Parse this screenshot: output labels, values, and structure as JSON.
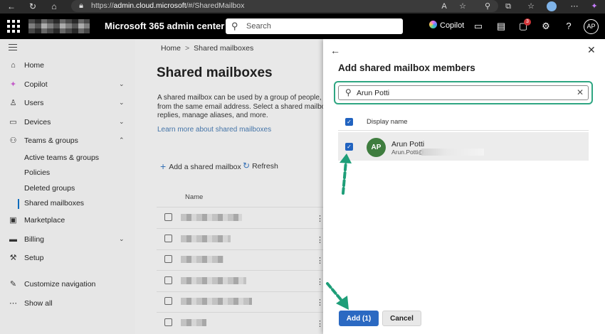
{
  "browser": {
    "url_prefix": "https://",
    "url_host": "admin.cloud.microsoft",
    "url_path": "/#/SharedMailbox",
    "notification_count": "3"
  },
  "header": {
    "app_title": "Microsoft 365 admin center",
    "search_placeholder": "Search",
    "copilot_label": "Copilot",
    "badge_count": "3",
    "avatar_initials": "AP"
  },
  "sidebar": {
    "items": [
      {
        "label": "Home",
        "icon": "home-icon"
      },
      {
        "label": "Copilot",
        "icon": "copilot-icon"
      },
      {
        "label": "Users",
        "icon": "user-icon"
      },
      {
        "label": "Devices",
        "icon": "devices-icon"
      },
      {
        "label": "Teams & groups",
        "icon": "teams-icon"
      },
      {
        "label": "Active teams & groups"
      },
      {
        "label": "Policies"
      },
      {
        "label": "Deleted groups"
      },
      {
        "label": "Shared mailboxes"
      },
      {
        "label": "Marketplace",
        "icon": "marketplace-icon"
      },
      {
        "label": "Billing",
        "icon": "billing-icon"
      },
      {
        "label": "Setup",
        "icon": "setup-icon"
      },
      {
        "label": "Customize navigation",
        "icon": "pencil-icon"
      },
      {
        "label": "Show all",
        "icon": "ellipsis-icon"
      }
    ]
  },
  "main": {
    "breadcrumb": [
      "Home",
      "Shared mailboxes"
    ],
    "title": "Shared mailboxes",
    "description": [
      "A shared mailbox can be used by a group of people, like",
      "from the same email address. Select a shared mailbox to",
      "replies, manage aliases, and more."
    ],
    "learn_more": "Learn more about shared mailboxes",
    "add_label": "Add a shared mailbox",
    "refresh_label": "Refresh",
    "name_column": "Name"
  },
  "panel": {
    "title": "Add shared mailbox members",
    "search_value": "Arun Potti",
    "column_header": "Display name",
    "results": [
      {
        "initials": "AP",
        "name": "Arun Potti",
        "email": "Arun.Potti@",
        "checked": true
      }
    ],
    "add_button": "Add (1)",
    "cancel_button": "Cancel"
  },
  "colors": {
    "accent": "#2b69c2",
    "highlight": "#2fa682",
    "annotation_arrow": "#1e9e78",
    "avatar_bg": "#3f7d3f"
  }
}
